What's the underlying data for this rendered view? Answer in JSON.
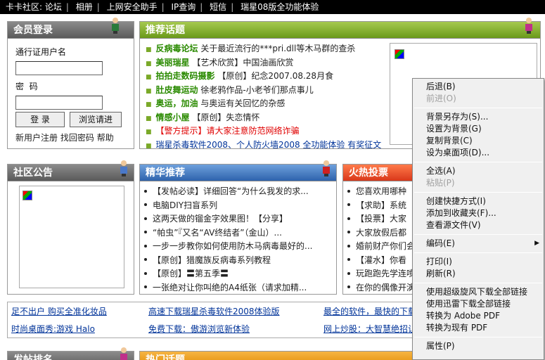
{
  "topnav": [
    "卡卡社区: 论坛",
    "相册",
    "上网安全助手",
    "IP查询",
    "短信",
    "瑞星08版全功能体验"
  ],
  "login": {
    "title": "会员登录",
    "user_label": "通行证用户名",
    "pwd_label": "密  码",
    "login_btn": "登 录",
    "browse_btn": "浏览请进",
    "links": [
      "新用户注册",
      "找回密码",
      "帮助"
    ]
  },
  "recommend": {
    "title": "推荐话题",
    "items": [
      {
        "cat": "反病毒论坛",
        "text": "关于最近流行的***pri.dll等木马群的查杀",
        "red": false
      },
      {
        "cat": "美丽瑞星",
        "text": "【艺术欣赏】中国油画欣赏",
        "red": false
      },
      {
        "cat": "拍拍走数码摄影",
        "text": "【原创】纪念2007.08.28月食",
        "red": false
      },
      {
        "cat": "肚皮舞运动",
        "text": "徐老鸦作品-小老爷们那点事儿",
        "red": false
      },
      {
        "cat": "奥运，加油",
        "text": "与奥运有关回忆的杂感",
        "red": false
      },
      {
        "cat": "情感小屋",
        "text": "【原创】失恋情怀",
        "red": false
      },
      {
        "cat": "",
        "text": "【警方提示】请大家注意防范网络诈骗",
        "red": true
      },
      {
        "cat": "",
        "text": "瑞星杀毒软件2008、个人防火墙2008 全功能体验 有奖征文",
        "red": false,
        "blue": true
      }
    ]
  },
  "notice": {
    "title": "社区公告"
  },
  "featured": {
    "title": "精华推荐",
    "items": [
      "【发帖必读】详细回答“为什么我发的求...",
      "电脑DIY扫盲系列",
      "这两天做的镏金字效果图！【分享】",
      "“帕虫”『又名“AV终结者”（金山）...",
      "一步一步教你如何使用防木马病毒最好的...",
      "【原创】猎魔族反病毒系列教程",
      "【原创】〓第五季〓",
      "一张绝对让你叫绝的A4纸张（请求加精..."
    ]
  },
  "hotvote": {
    "title": "火热投票",
    "items": [
      "您喜欢用哪种",
      "【求助】系统",
      "【投票】大家",
      "大家放假后都",
      "婚前财产你们会",
      "【灌水】你看",
      "玩跑跑先学连喷",
      "在你的偶像开演"
    ]
  },
  "ads": [
    [
      "足不出户 购买全准化妆品",
      "高速下载瑞星杀毒软件2008体验版",
      "最全的软件，最快的下载"
    ],
    [
      "时尚桌面秀:游戏 Halo",
      "免费下载：傲游浏览新体验",
      "网上炒股：大智慧绝招让"
    ]
  ],
  "bottom": {
    "left_title": "发帖排名",
    "right_title": "热门话题"
  },
  "context_menu": [
    {
      "label": "后退(B)"
    },
    {
      "label": "前进(O)",
      "disabled": true
    },
    {
      "sep": true
    },
    {
      "label": "背景另存为(S)..."
    },
    {
      "label": "设置为背景(G)"
    },
    {
      "label": "复制背景(C)"
    },
    {
      "label": "设为桌面项(D)..."
    },
    {
      "sep": true
    },
    {
      "label": "全选(A)"
    },
    {
      "label": "粘贴(P)",
      "disabled": true
    },
    {
      "sep": true
    },
    {
      "label": "创建快捷方式(I)"
    },
    {
      "label": "添加到收藏夹(F)..."
    },
    {
      "label": "查看源文件(V)"
    },
    {
      "sep": true
    },
    {
      "label": "编码(E)",
      "submenu": true
    },
    {
      "sep": true
    },
    {
      "label": "打印(I)"
    },
    {
      "label": "刷新(R)"
    },
    {
      "sep": true
    },
    {
      "label": "使用超级旋风下载全部链接"
    },
    {
      "label": "使用迅雷下载全部链接"
    },
    {
      "label": "转换为 Adobe PDF"
    },
    {
      "label": "转换为现有 PDF"
    },
    {
      "sep": true
    },
    {
      "label": "属性(P)"
    }
  ],
  "colors": {
    "green_cat": "#2a8a00",
    "red_alert": "#e00000",
    "link_blue": "#003399"
  }
}
